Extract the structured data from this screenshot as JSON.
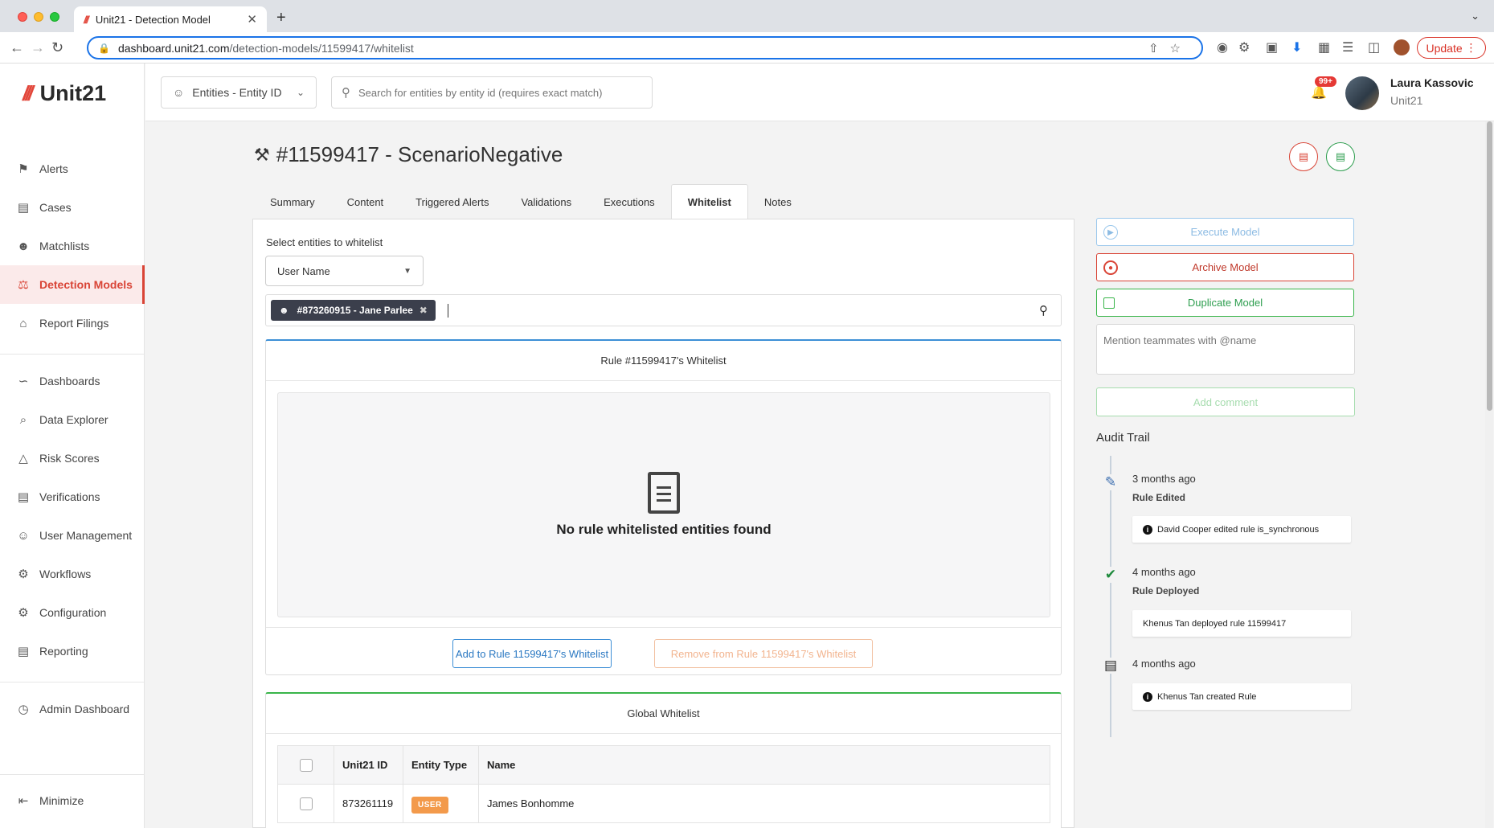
{
  "browser": {
    "tab_title": "Unit21 - Detection Model",
    "tab_close": "✕",
    "new_tab": "+",
    "url_domain": "dashboard.unit21.com",
    "url_path": "/detection-models/11599417/whitelist",
    "update_label": "Update"
  },
  "sidebar": {
    "logo_text": "Unit21",
    "items": [
      {
        "label": "Alerts",
        "icon": "flag-icon"
      },
      {
        "label": "Cases",
        "icon": "briefcase-icon"
      },
      {
        "label": "Matchlists",
        "icon": "user-x-icon"
      },
      {
        "label": "Detection Models",
        "icon": "scale-icon"
      },
      {
        "label": "Report Filings",
        "icon": "bank-icon"
      },
      {
        "label": "Dashboards",
        "icon": "chart-line-icon"
      },
      {
        "label": "Data Explorer",
        "icon": "search-list-icon"
      },
      {
        "label": "Risk Scores",
        "icon": "warning-icon"
      },
      {
        "label": "Verifications",
        "icon": "id-card-icon"
      },
      {
        "label": "User Management",
        "icon": "users-icon"
      },
      {
        "label": "Workflows",
        "icon": "workflow-icon"
      },
      {
        "label": "Configuration",
        "icon": "gear-icon"
      },
      {
        "label": "Reporting",
        "icon": "report-icon"
      },
      {
        "label": "Admin Dashboard",
        "icon": "globe-icon"
      }
    ],
    "minimize_label": "Minimize"
  },
  "header": {
    "entity_select": "Entities - Entity ID",
    "search_placeholder": "Search for entities by entity id (requires exact match)",
    "notification_count": "99+",
    "user_name": "Laura Kassovic",
    "user_org": "Unit21"
  },
  "page": {
    "title": "#11599417 - ScenarioNegative",
    "tabs": [
      "Summary",
      "Content",
      "Triggered Alerts",
      "Validations",
      "Executions",
      "Whitelist",
      "Notes"
    ],
    "active_tab": "Whitelist"
  },
  "whitelist": {
    "select_label": "Select entities to whitelist",
    "type_value": "User Name",
    "selected_tag": "#873260915 - Jane Parlee",
    "rule_card_title": "Rule #11599417's Whitelist",
    "empty_message": "No rule whitelisted entities found",
    "add_button": "Add to Rule 11599417's Whitelist",
    "remove_button": "Remove from Rule 11599417's Whitelist",
    "global_card_title": "Global Whitelist",
    "columns": [
      "Unit21 ID",
      "Entity Type",
      "Name"
    ],
    "rows": [
      {
        "id": "873261119",
        "type": "USER",
        "name": "James Bonhomme"
      }
    ]
  },
  "actions": {
    "execute": "Execute Model",
    "archive": "Archive Model",
    "duplicate": "Duplicate Model",
    "comment_placeholder": "Mention teammates with @name",
    "add_comment": "Add comment"
  },
  "audit": {
    "title": "Audit Trail",
    "events": [
      {
        "time": "3 months ago",
        "label": "Rule Edited",
        "detail": "David Cooper edited rule is_synchronous",
        "icon": "pencil-icon",
        "info": true
      },
      {
        "time": "4 months ago",
        "label": "Rule Deployed",
        "detail": "Khenus Tan deployed rule 11599417",
        "icon": "check-icon",
        "info": false
      },
      {
        "time": "4 months ago",
        "label": "",
        "detail": "Khenus Tan created Rule",
        "icon": "briefcase-icon",
        "info": true
      }
    ]
  },
  "colors": {
    "brand_red": "#d94436",
    "accent_blue": "#3d8fd6",
    "accent_green": "#39b54a",
    "user_badge": "#f39a4b"
  }
}
